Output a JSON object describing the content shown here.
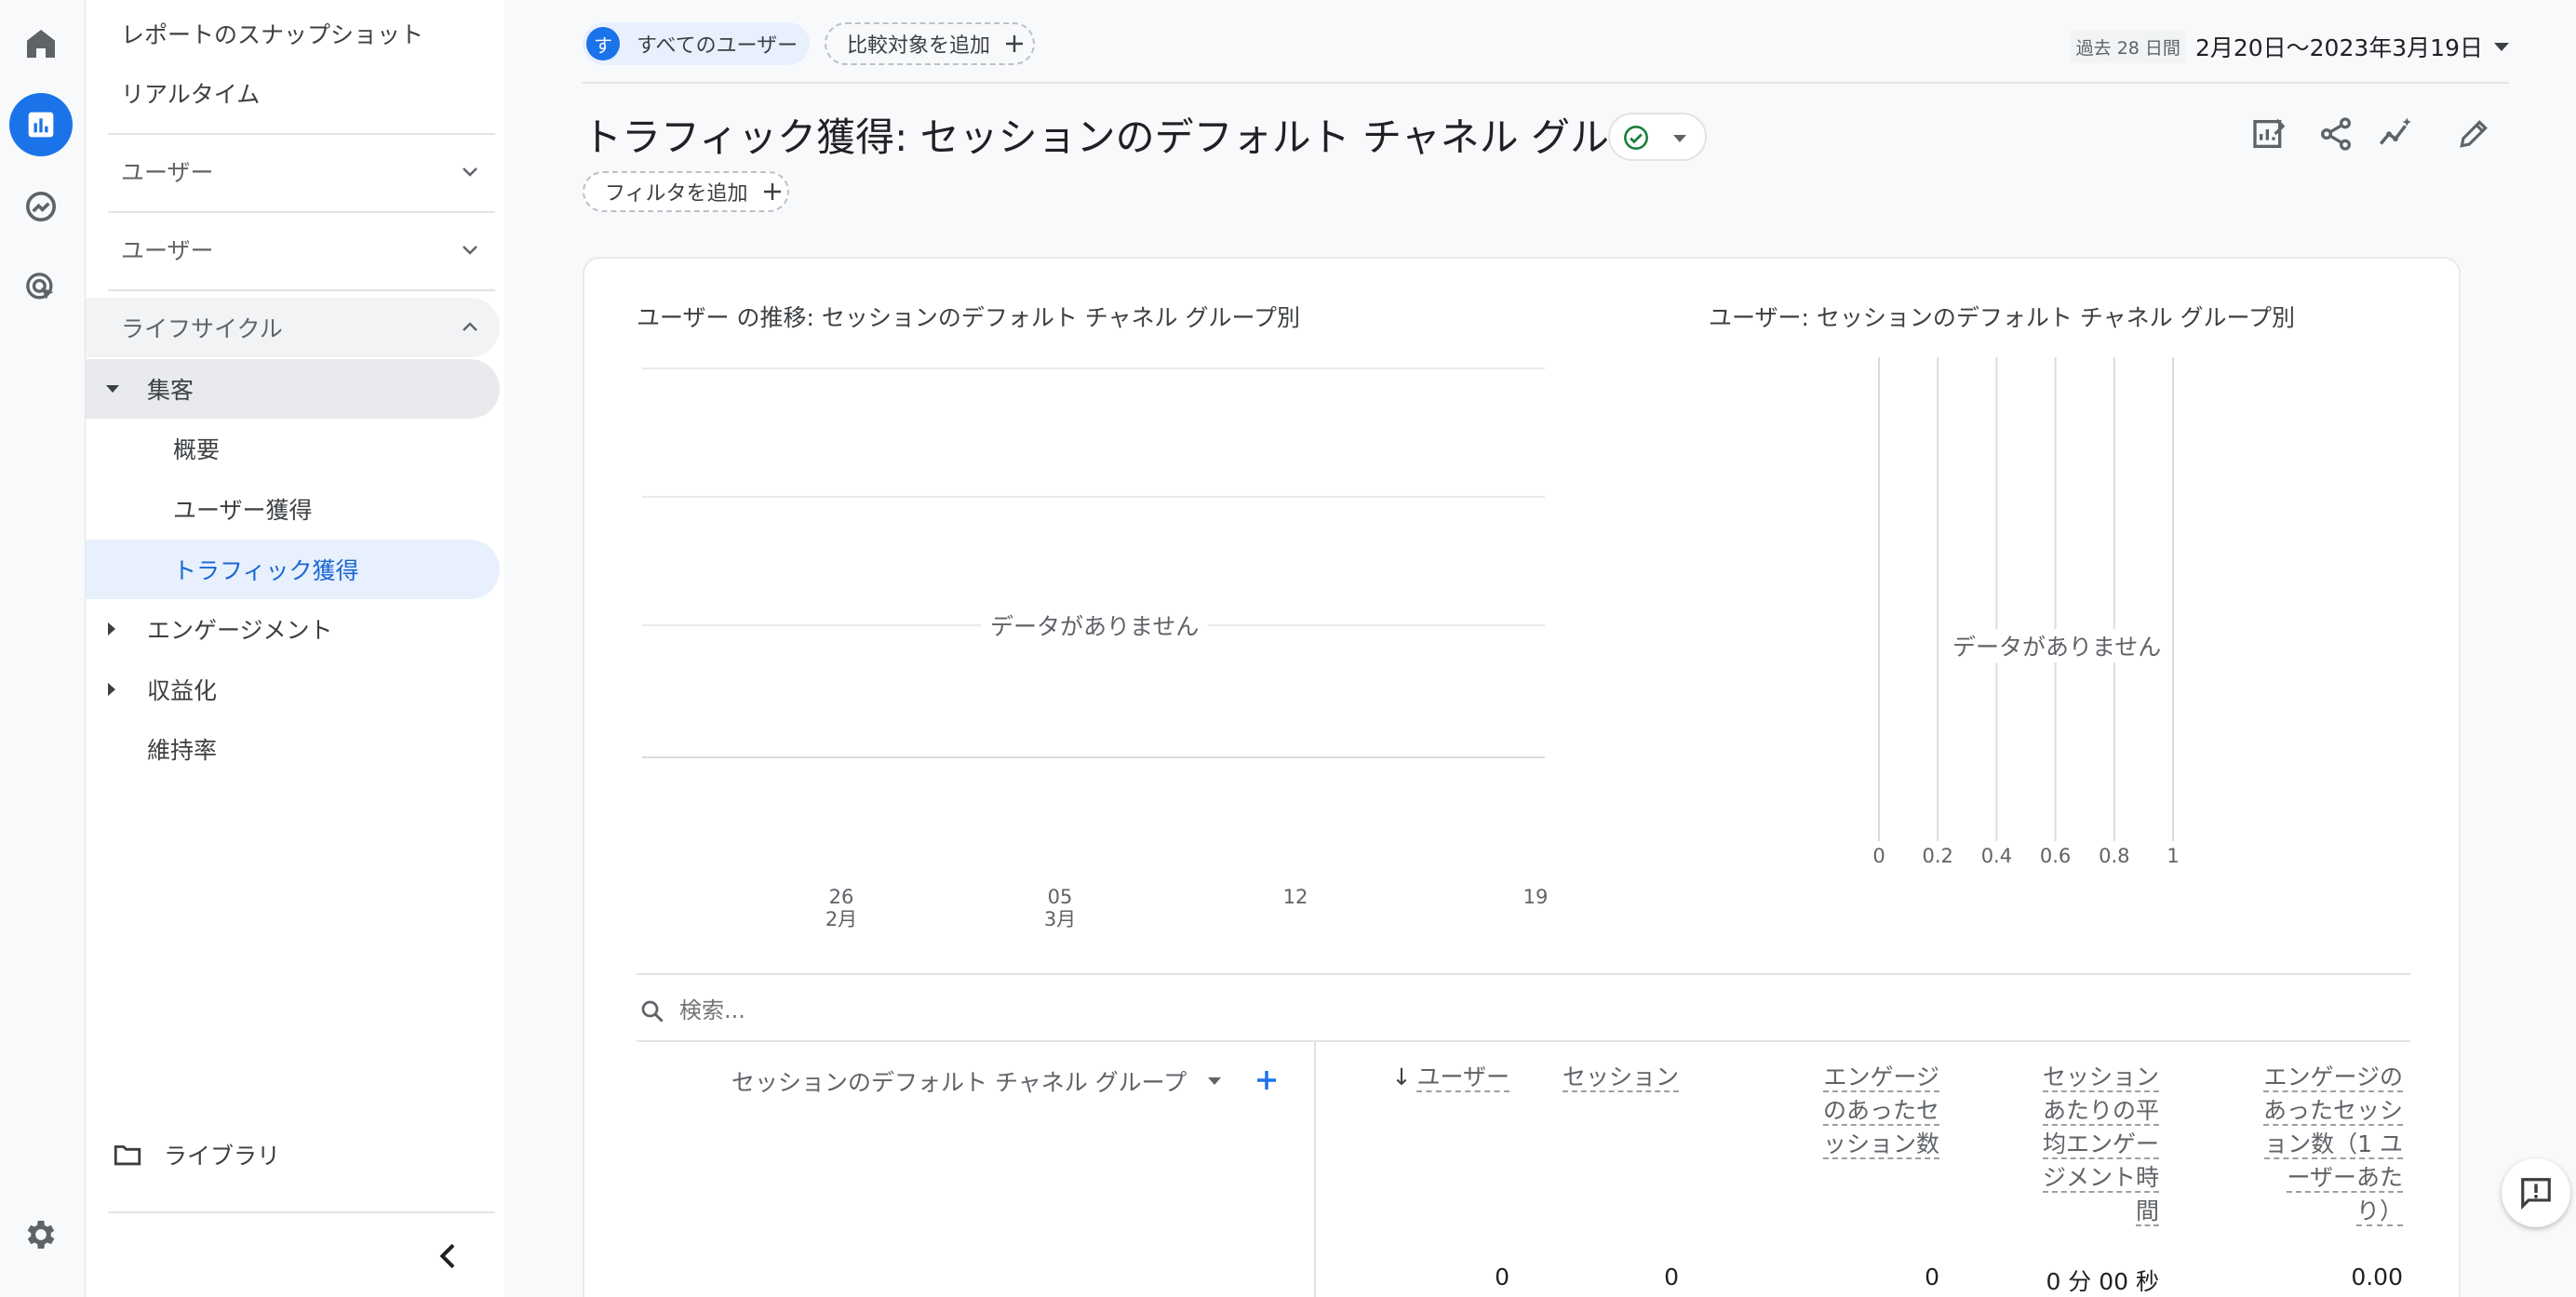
{
  "nav": {
    "snapshot": "レポートのスナップショット",
    "realtime": "リアルタイム",
    "user_section_1": "ユーザー",
    "user_section_2": "ユーザー",
    "lifecycle": "ライフサイクル",
    "acquisition": "集客",
    "overview": "概要",
    "user_acquisition": "ユーザー獲得",
    "traffic_acquisition": "トラフィック獲得",
    "engagement": "エンゲージメント",
    "monetization": "収益化",
    "retention": "維持率",
    "library": "ライブラリ"
  },
  "topbar": {
    "segment_avatar": "す",
    "segment_label": "すべてのユーザー",
    "add_comparison": "比較対象を追加",
    "date_prefix": "過去 28 日間",
    "date_range": "2月20日～2023年3月19日"
  },
  "page": {
    "title": "トラフィック獲得: セッションのデフォルト チャネル グループ",
    "add_filter": "フィルタを追加"
  },
  "chart_data": [
    {
      "type": "line",
      "title": "ユーザー の推移: セッションのデフォルト チャネル グループ別",
      "no_data": "データがありません",
      "x_ticks": [
        {
          "day": "26",
          "month": "2月"
        },
        {
          "day": "05",
          "month": "3月"
        },
        {
          "day": "12",
          "month": ""
        },
        {
          "day": "19",
          "month": ""
        }
      ],
      "series": []
    },
    {
      "type": "bar",
      "title": "ユーザー: セッションのデフォルト チャネル グループ別",
      "no_data": "データがありません",
      "x_ticks": [
        "0",
        "0.2",
        "0.4",
        "0.6",
        "0.8",
        "1"
      ],
      "xlim": [
        0,
        1
      ],
      "series": []
    }
  ],
  "table": {
    "search_placeholder": "検索...",
    "dimension_header": "セッションのデフォルト チャネル グループ",
    "sort_arrow": "↓",
    "columns": [
      {
        "label": "ユーザー",
        "total": "0"
      },
      {
        "label": "セッション",
        "total": "0"
      },
      {
        "label": "エンゲージのあったセッション数",
        "total": "0"
      },
      {
        "label": "セッションあたりの平均エンゲージメント時間",
        "total": "0 分 00 秒"
      },
      {
        "label": "エンゲージのあったセッション数（1 ユーザーあたり）",
        "total": "0.00"
      }
    ]
  },
  "colors": {
    "accent": "#1a73e8",
    "selected_bg": "#e8f0fe",
    "success": "#188038"
  }
}
